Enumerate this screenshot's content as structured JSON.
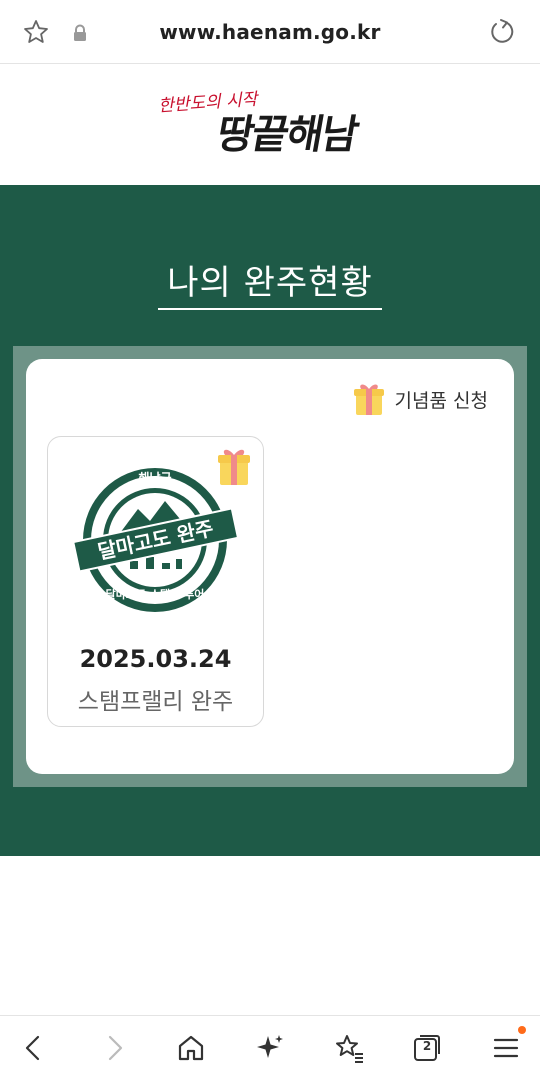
{
  "browser": {
    "url": "www.haenam.go.kr",
    "icons": [
      "star-icon",
      "lock-icon",
      "reload-icon"
    ]
  },
  "logo": {
    "small_text": "한반도의 시작",
    "big_text": "땅끝해남"
  },
  "main": {
    "title": "나의 완주현황",
    "gift_request_label": "기념품 신청"
  },
  "stamps": [
    {
      "badge_top": "해남군",
      "badge_ribbon": "달마고도 완주",
      "badge_bottom": "달마고도 스탬프 투어",
      "date": "2025.03.24",
      "label": "스탬프랠리 완주"
    }
  ],
  "bottom_nav": {
    "tab_count": "2",
    "icons": [
      "back-icon",
      "forward-icon",
      "home-icon",
      "sparkle-icon",
      "bookmarks-icon",
      "tabs-icon",
      "menu-icon"
    ]
  },
  "colors": {
    "primary_green": "#1e5a47",
    "frame_green": "#6e9387",
    "notification_dot": "#ff6b1a"
  }
}
